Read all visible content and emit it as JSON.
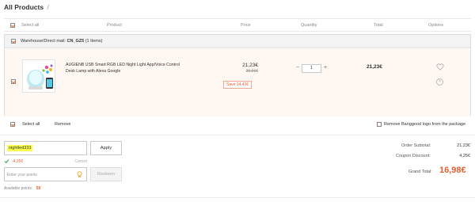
{
  "page": {
    "title": "All Products",
    "title_sep": "/"
  },
  "table_header": {
    "select_all": "Select all",
    "product": "Product",
    "price": "Price",
    "quantity": "Quantity",
    "total": "Total",
    "options": "Options"
  },
  "warehouse": {
    "label": "Warehouse/Direct mail:",
    "code": "CN_GZ5",
    "count": "(1 Items)",
    "checked": true
  },
  "item": {
    "name": "AUGIENB USB Smart RGB LED Night Light App/Voice Control Desk Lamp with Alexa Google",
    "price": "21,23€",
    "original_price": "35,66€",
    "save": "Save 14,43€",
    "quantity": "1",
    "minus": "−",
    "plus": "+",
    "total": "21,23€",
    "checked": true,
    "heart_icon": "heart-icon",
    "remove_icon": "close-icon"
  },
  "footer_actions": {
    "select_all": "Select all",
    "remove": "Remove",
    "remove_logo": "Remove Banggood logo from the package",
    "select_all_checked": true,
    "remove_logo_checked": false
  },
  "coupon": {
    "code": "nightled333",
    "apply_label": "Apply",
    "discount": "-4,25€",
    "cancel_label": "Cancel"
  },
  "points": {
    "placeholder": "Enter your points",
    "redeem_label": "Redeem",
    "available_label": "Available points:",
    "available_value": "59"
  },
  "summary": {
    "subtotal_label": "Order Subtotal:",
    "subtotal_value": "21,23€",
    "coupon_label": "Coupon Discount:",
    "coupon_value": "4,25€",
    "grand_label": "Grand Total:",
    "grand_value": "16,98€"
  },
  "colors": {
    "accent": "#e35f34",
    "row_bg": "#fff7f2",
    "highlight": "#ffff4d",
    "success": "#3aa94a"
  }
}
